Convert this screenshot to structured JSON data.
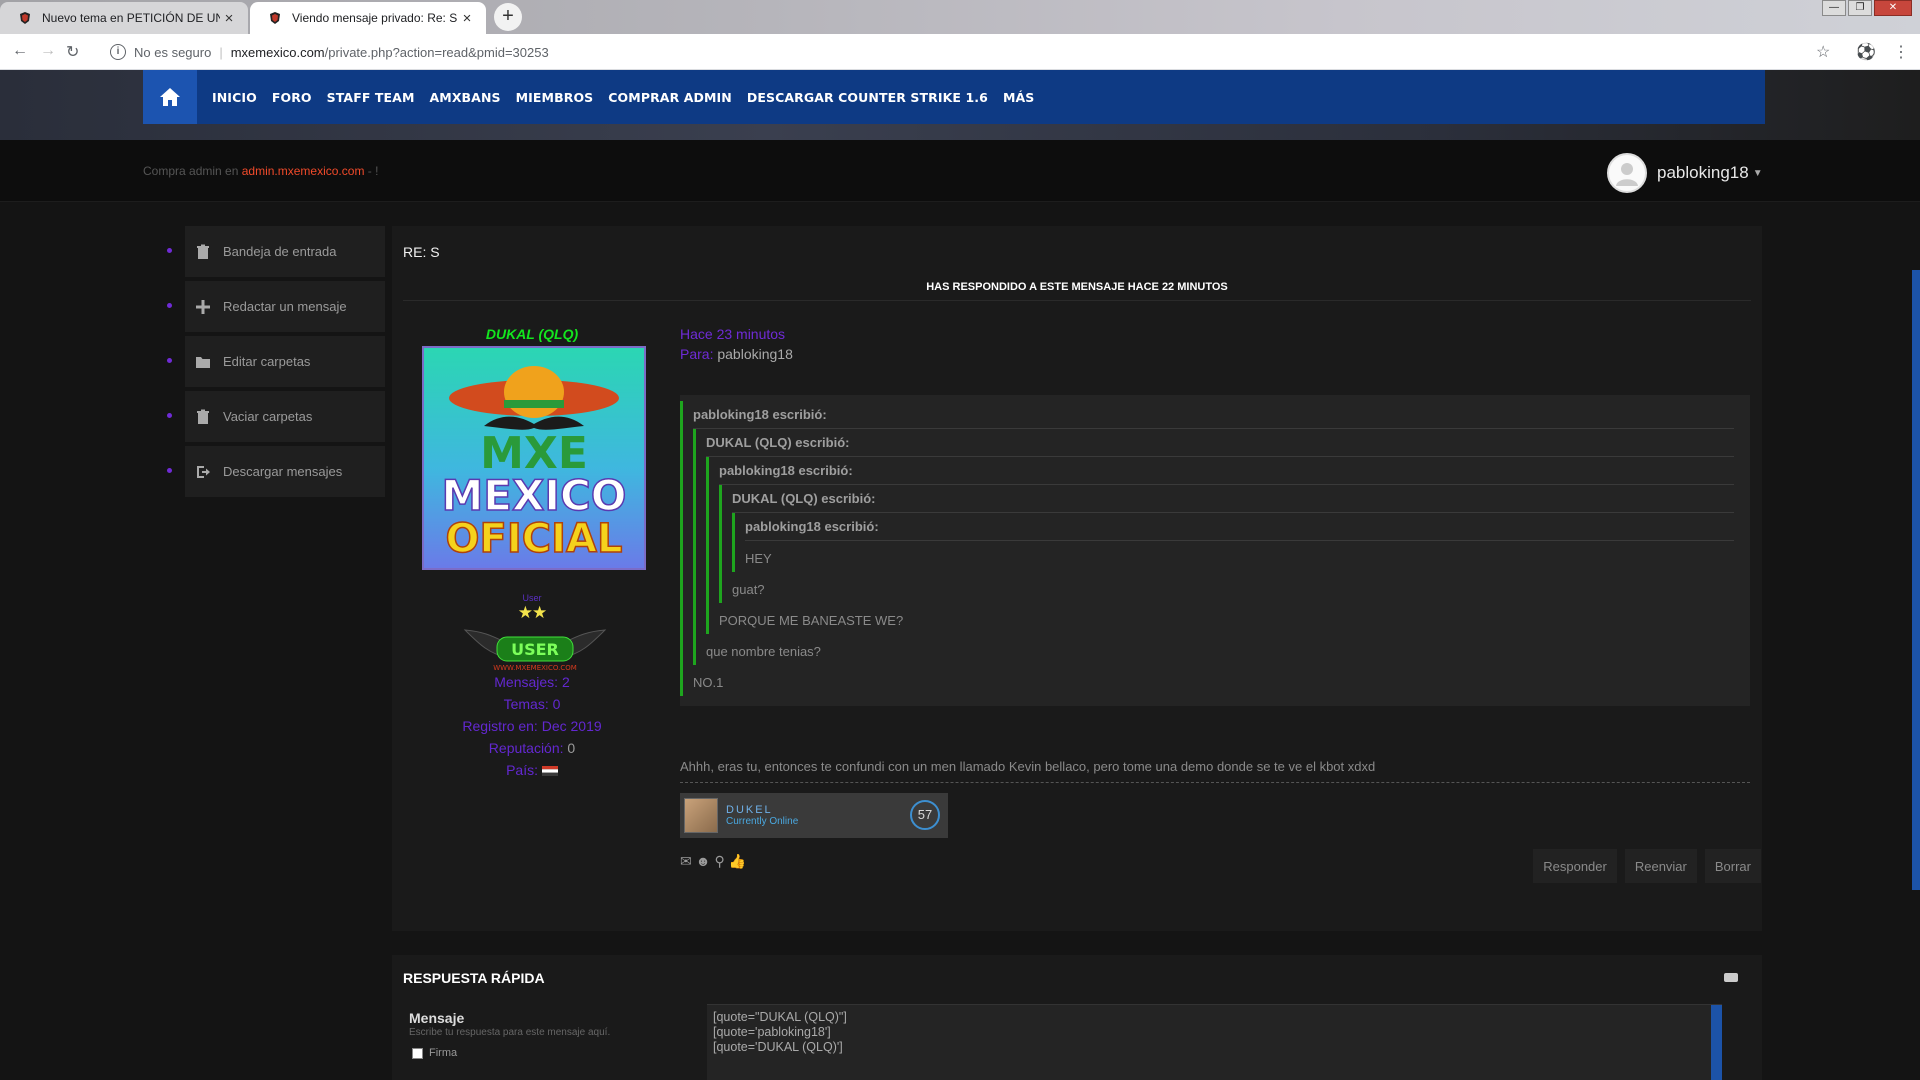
{
  "browser": {
    "tabs": [
      {
        "title": "Nuevo tema en PETICIÓN DE UN",
        "active": false
      },
      {
        "title": "Viendo mensaje privado: Re: S",
        "active": true
      }
    ],
    "new_tab": "+",
    "url_status": "No es seguro",
    "url_domain": "mxemexico.com",
    "url_path": "/private.php?action=read&pmid=30253"
  },
  "nav": {
    "items": [
      "INICIO",
      "FORO",
      "STAFF TEAM",
      "AMXBANS",
      "MIEMBROS",
      "COMPRAR ADMIN",
      "DESCARGAR COUNTER STRIKE 1.6",
      "MÁS"
    ]
  },
  "promo": {
    "prefix": "Compra admin en",
    "link": "admin.mxemexico.com",
    "suffix": "- !"
  },
  "user": {
    "name": "pabloking18"
  },
  "sidebar": {
    "items": [
      {
        "label": "Bandeja de entrada",
        "icon": "trash-icon"
      },
      {
        "label": "Redactar un mensaje",
        "icon": "plus-icon"
      },
      {
        "label": "Editar carpetas",
        "icon": "folder-icon"
      },
      {
        "label": "Vaciar carpetas",
        "icon": "trash-icon"
      },
      {
        "label": "Descargar mensajes",
        "icon": "export-icon"
      }
    ]
  },
  "message": {
    "title": "RE: S",
    "replied_notice": "HAS RESPONDIDO A ESTE MENSAJE HACE 22 MINUTOS",
    "when": "Hace 23 minutos",
    "to_label": "Para:",
    "to_value": "pabloking18"
  },
  "poster": {
    "name": "DUKAL (QLQ)",
    "logo_line1": "MXE",
    "logo_line2": "MEXICO",
    "logo_line3": "OFICIAL",
    "rank": "User",
    "rank_stars": "★★",
    "badge_text": "USER",
    "badge_site": "WWW.MXEMEXICO.COM",
    "stats": {
      "messages_label": "Mensajes:",
      "messages": "2",
      "topics_label": "Temas:",
      "topics": "0",
      "registered_label": "Registro en:",
      "registered": "Dec 2019",
      "reputation_label": "Reputación:",
      "reputation": "0",
      "country_label": "País:"
    }
  },
  "quotes": {
    "q1_head": "pabloking18 escribió:",
    "q2_head": "DUKAL (QLQ) escribió:",
    "q3_head": "pabloking18 escribió:",
    "q4_head": "DUKAL (QLQ) escribió:",
    "q5_head": "pabloking18 escribió:",
    "q5_text": "HEY",
    "q4_text": "guat?",
    "q3_text": "PORQUE ME BANEASTE WE?",
    "q2_text": "que nombre tenias?",
    "q1_text": "NO.1"
  },
  "reply_text": "Ahhh, eras tu, entonces te confundi con un men llamado Kevin bellaco, pero tome una demo donde se te ve el kbot xdxd",
  "signature_card": {
    "name": "DUKEL",
    "status": "Currently Online",
    "number": "57"
  },
  "actions": {
    "reply": "Responder",
    "forward": "Reenviar",
    "delete": "Borrar"
  },
  "quick_reply": {
    "title": "RESPUESTA RÁPIDA",
    "label": "Mensaje",
    "hint": "Escribe tu respuesta para este mensaje aquí.",
    "firma": "Firma",
    "lines": [
      "[quote=\"DUKAL (QLQ)\"]",
      "[quote='pabloking18']",
      "[quote='DUKAL (QLQ)']"
    ]
  },
  "colors": {
    "nav_bg": "#0e3a84",
    "nav_home": "#1c54b0",
    "accent_purple": "#6328d0",
    "quote_green": "#1ea51e",
    "link_red": "#f04a2a"
  }
}
